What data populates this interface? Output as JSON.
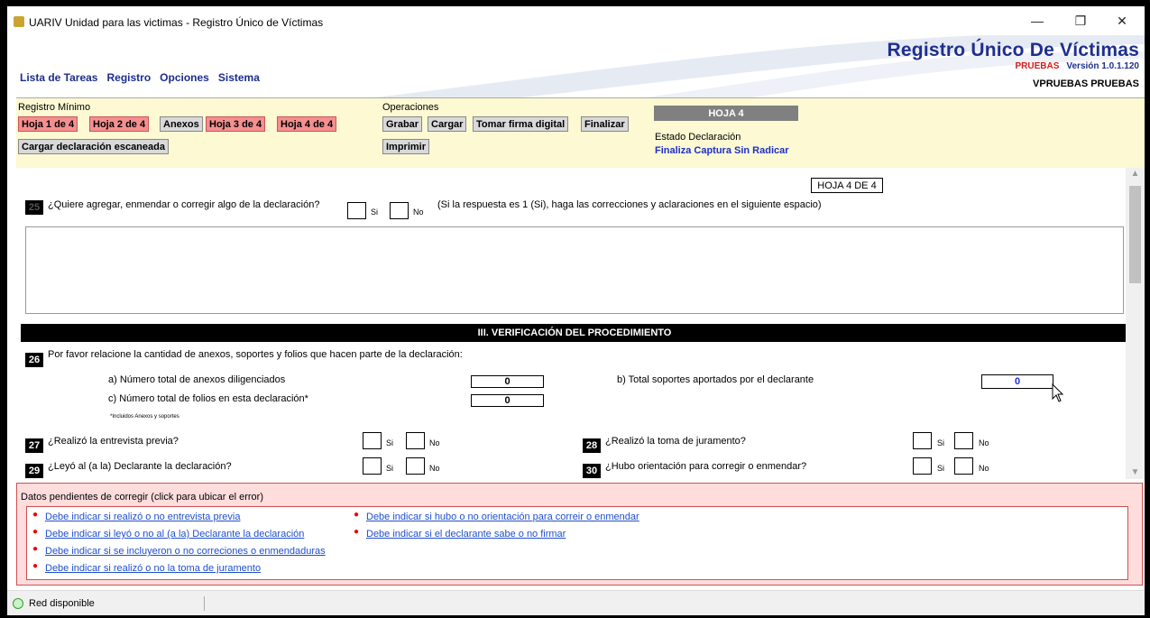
{
  "window": {
    "title": "UARIV Unidad para las victimas - Registro Único de Víctimas",
    "controls": [
      "—",
      "❐",
      "✕"
    ]
  },
  "brand": {
    "title": "Registro Único De Víctimas",
    "env": "PRUEBAS",
    "version": "Versión 1.0.1.120",
    "user": "VPRUEBAS PRUEBAS",
    "title_color": "#1f2f8f",
    "env_color": "#d41c1c"
  },
  "menu": {
    "items": [
      "Lista de Tareas",
      "Registro",
      "Opciones",
      "Sistema"
    ]
  },
  "toolbar": {
    "registro_label": "Registro Mínimo",
    "registro_buttons": [
      "Hoja 1 de 4",
      "Hoja 2 de 4",
      "Anexos",
      "Hoja 3 de 4",
      "Hoja 4 de 4"
    ],
    "cargar_button": "Cargar declaración escaneada",
    "operaciones_label": "Operaciones",
    "operaciones_buttons": [
      "Grabar",
      "Cargar",
      "Tomar firma digital",
      "Finalizar"
    ],
    "imprimir_button": "Imprimir",
    "hoja_banner": "HOJA 4",
    "estado_label": "Estado Declaración",
    "estado_value": "Finaliza Captura Sin Radicar",
    "bg_color": "#fcf9d3",
    "red_button_color": "#f58f8f"
  },
  "form": {
    "hoja_box": "HOJA 4 DE 4",
    "q25": {
      "num": "25",
      "text": "¿Quiere agregar, enmendar o corregir algo de la declaración?",
      "si": "Si",
      "no": "No",
      "note": "(Si la respuesta es 1 (Si), haga las correcciones y aclaraciones en el siguiente espacio)"
    },
    "section_title": "III. VERIFICACIÓN DEL PROCEDIMIENTO",
    "q26": {
      "num": "26",
      "text": "Por favor relacione la cantidad de anexos, soportes y folios que hacen parte de la declaración:",
      "a_label": "a) Número total de anexos diligenciados",
      "a_value": "0",
      "b_label": "b) Total soportes aportados por el declarante",
      "b_value": "0",
      "c_label": "c) Número total de folios en esta declaración*",
      "c_value": "0",
      "note": "*Incluidos Anexos y soportes"
    },
    "q27": {
      "num": "27",
      "text": "¿Realizó la entrevista previa?",
      "si": "Si",
      "no": "No"
    },
    "q28": {
      "num": "28",
      "text": "¿Realizó la toma de juramento?",
      "si": "Si",
      "no": "No"
    },
    "q29": {
      "num": "29",
      "text": "¿Leyó al (a la) Declarante la declaración?",
      "si": "Si",
      "no": "No"
    },
    "q30": {
      "num": "30",
      "text": "¿Hubo orientación para corregir o enmendar?",
      "si": "Si",
      "no": "No"
    }
  },
  "errors": {
    "title": "Datos pendientes de corregir (click para ubicar el error)",
    "col1": [
      "Debe indicar si realizó o no entrevista previa",
      "Debe indicar si leyó o no al (a la) Declarante la declaración",
      "Debe indicar si se incluyeron o no correciones o enmendaduras",
      "Debe indicar si realizó o no la toma de juramento"
    ],
    "col2": [
      "Debe indicar si hubo o no orientación para correir o enmendar",
      "Debe indicar si el declarante sabe o no firmar"
    ],
    "bg_color": "#ffdddd",
    "link_color": "#1f4fcc"
  },
  "status": {
    "text": "Red disponible"
  }
}
